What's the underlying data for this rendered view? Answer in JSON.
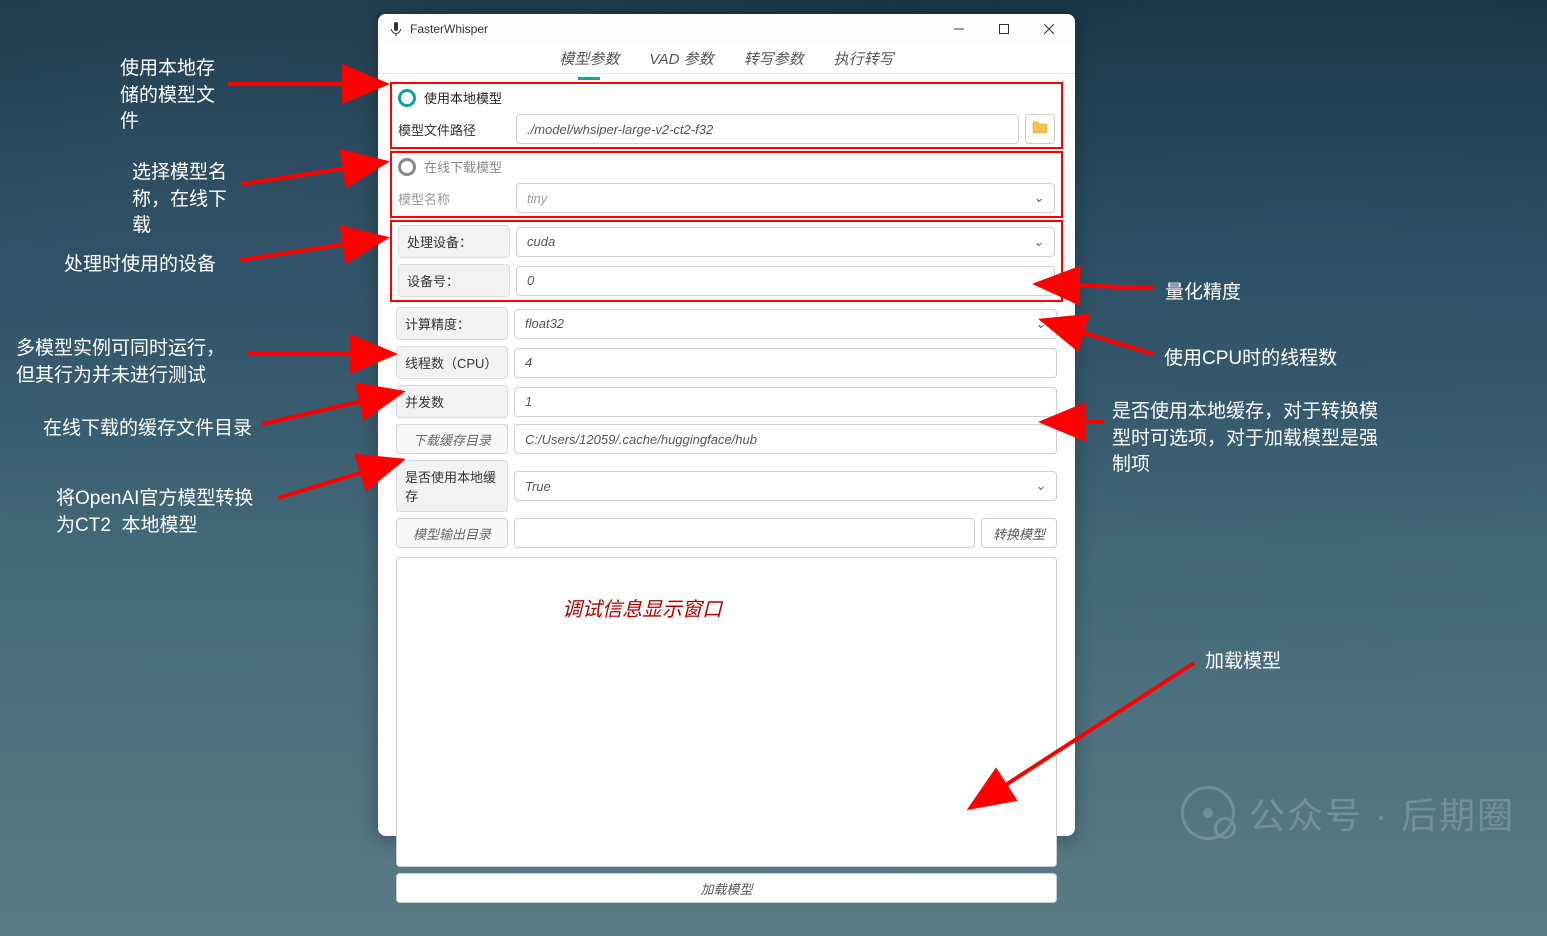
{
  "window": {
    "title": "FasterWhisper"
  },
  "tabs": {
    "model_params": "模型参数",
    "vad_params": "VAD 参数",
    "transcribe_params": "转写参数",
    "run_transcribe": "执行转写"
  },
  "radio": {
    "use_local_model": "使用本地模型",
    "online_download_model": "在线下载模型"
  },
  "fields": {
    "model_path_label": "模型文件路径",
    "model_path_value": "./model/whsiper-large-v2-ct2-f32",
    "model_name_label": "模型名称",
    "model_name_value": "tiny",
    "device_label": "处理设备：",
    "device_value": "cuda",
    "device_index_label": "设备号：",
    "device_index_value": "0",
    "compute_type_label": "计算精度：",
    "compute_type_value": "float32",
    "cpu_threads_label": "线程数（CPU）",
    "cpu_threads_value": "4",
    "num_workers_label": "并发数",
    "num_workers_value": "1",
    "download_cache_dir_label": "下载缓存目录",
    "download_cache_dir_value": "C:/Users/12059/.cache/huggingface/hub",
    "use_local_cache_label": "是否使用本地缓存",
    "use_local_cache_value": "True",
    "model_output_dir_label": "模型输出目录",
    "convert_model_btn": "转换模型",
    "load_model_btn": "加载模型"
  },
  "annotations": {
    "a1": "使用本地存\n储的模型文\n件",
    "a2": "选择模型名\n称，在线下\n载",
    "a3": "处理时使用的设备",
    "a4": "多模型实例可同时运行，\n但其行为并未进行测试",
    "a5": "在线下载的缓存文件目录",
    "a6": "将OpenAI官方模型转换\n为CT2  本地模型",
    "a7": "量化精度",
    "a8": "使用CPU时的线程数",
    "a9": "是否使用本地缓存，对于转换模\n型时可选项，对于加载模型是强\n制项",
    "a10": "加载模型",
    "debug_window": "调试信息显示窗口"
  },
  "watermark": {
    "text": "公众号 · 后期圈"
  }
}
